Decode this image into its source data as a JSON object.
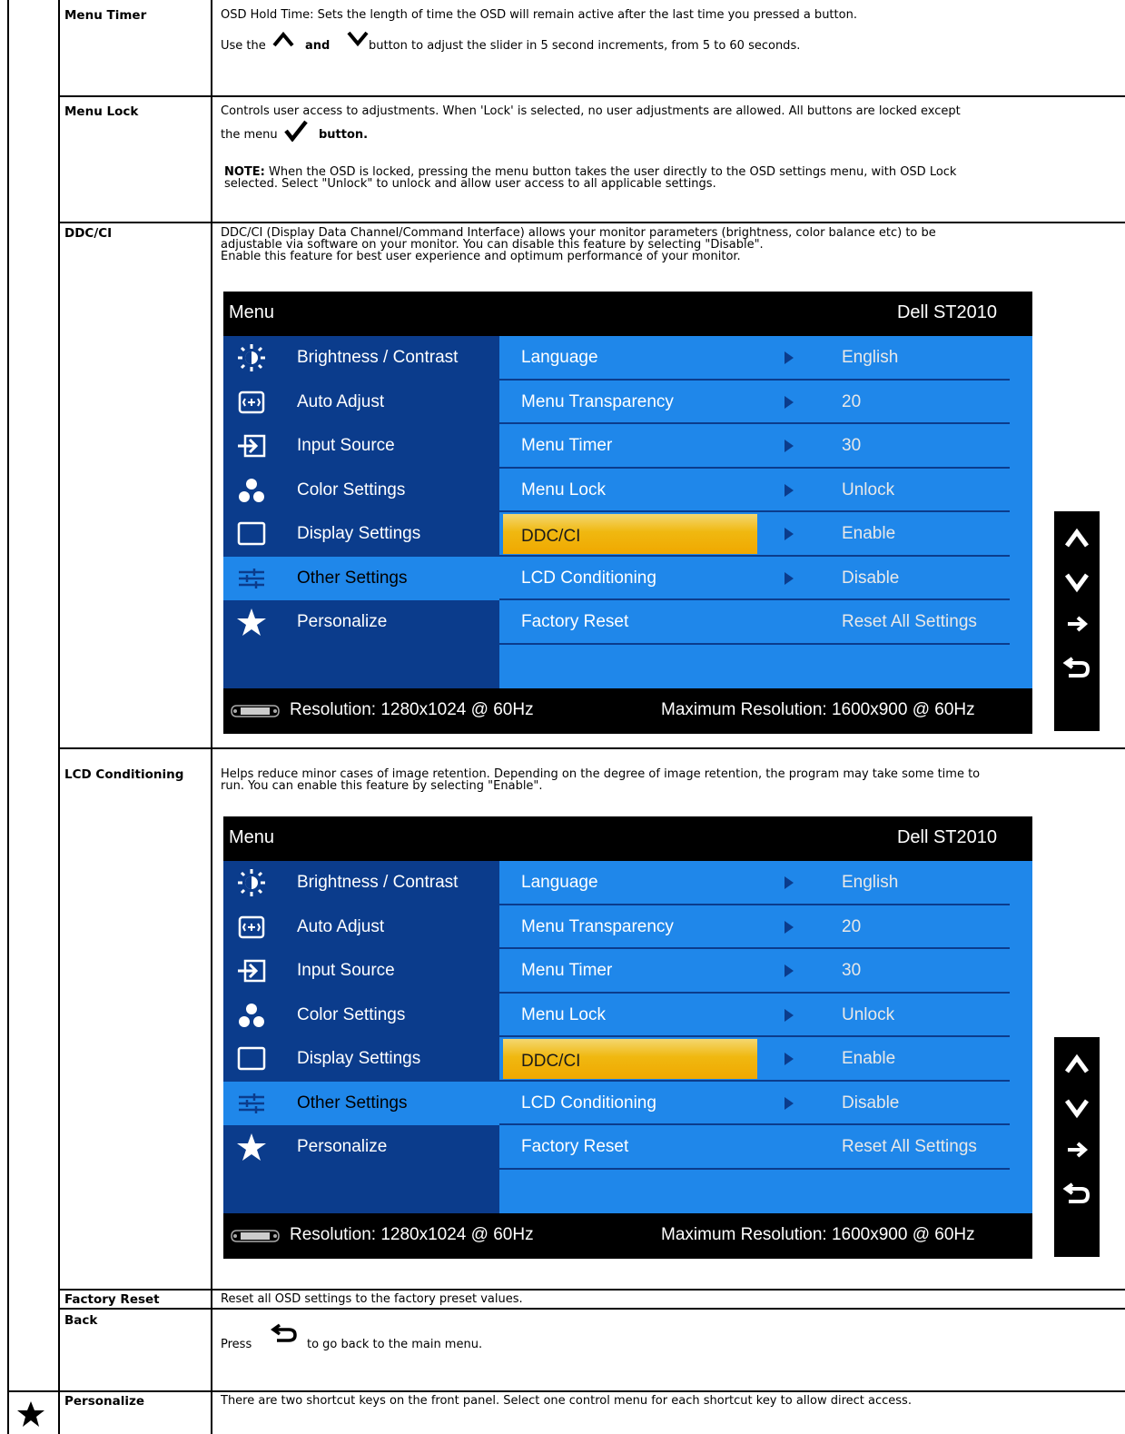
{
  "rows": {
    "menu_timer": {
      "label": "Menu Timer",
      "line1": "OSD Hold Time: Sets the length of time the OSD will remain active after the last time you pressed a button.",
      "line2_pre": "Use the",
      "line2_and": "and",
      "line2_post": "button to adjust the slider in 5 second increments, from 5 to 60 seconds."
    },
    "menu_lock": {
      "label": "Menu Lock",
      "line1": "Controls user access to adjustments. When 'Lock' is selected, no user adjustments are allowed. All buttons are locked except",
      "line2_pre": "the menu",
      "line2_post": "button.",
      "note_label": "NOTE:",
      "note_text": "When the OSD is locked, pressing the menu button takes the user directly to the OSD settings menu, with OSD Lock",
      "note_text2": "selected. Select \"Unlock\" to unlock and allow user access to all applicable settings."
    },
    "ddcci": {
      "label": "DDC/CI",
      "line1": "DDC/CI (Display Data Channel/Command Interface) allows your monitor parameters (brightness, color balance etc) to be",
      "line2": "adjustable via software on your monitor. You can disable this feature by selecting \"Disable\".",
      "line3": "Enable this feature for best user experience and optimum performance of your monitor."
    },
    "lcd_conditioning": {
      "label": "LCD Conditioning",
      "line1": "Helps reduce minor cases of image retention. Depending on the degree of image retention, the program may take some time to",
      "line2": "run. You can enable this feature by selecting \"Enable\"."
    },
    "factory_reset": {
      "label": "Factory Reset",
      "text": "Reset all OSD settings to the factory preset values."
    },
    "back": {
      "label": "Back",
      "pre": "Press",
      "post": "to go back to the main menu."
    },
    "personalize": {
      "label": "Personalize",
      "text": "There are two shortcut keys on the front panel. Select one control menu for each shortcut key to allow direct access."
    }
  },
  "osd": {
    "title": "Menu",
    "model": "Dell ST2010",
    "left_items": [
      {
        "label": "Brightness / Contrast",
        "icon": "brightness-icon"
      },
      {
        "label": "Auto Adjust",
        "icon": "auto-adjust-icon"
      },
      {
        "label": "Input Source",
        "icon": "input-source-icon"
      },
      {
        "label": "Color Settings",
        "icon": "color-settings-icon"
      },
      {
        "label": "Display Settings",
        "icon": "display-settings-icon"
      },
      {
        "label": "Other Settings",
        "icon": "other-settings-icon",
        "selected": true
      },
      {
        "label": "Personalize",
        "icon": "star-icon"
      }
    ],
    "right_items": [
      {
        "name": "Language",
        "value": "English"
      },
      {
        "name": "Menu Transparency",
        "value": "20"
      },
      {
        "name": "Menu Timer",
        "value": "30"
      },
      {
        "name": "Menu Lock",
        "value": "Unlock"
      },
      {
        "name": "DDC/CI",
        "value": "Enable",
        "highlighted": true
      },
      {
        "name": "LCD Conditioning",
        "value": "Disable"
      },
      {
        "name": "Factory Reset",
        "value": "Reset All Settings"
      }
    ],
    "resolution": "Resolution: 1280x1024 @ 60Hz",
    "max_resolution": "Maximum  Resolution: 1600x900 @ 60Hz"
  },
  "colors": {
    "osd_dark_blue": "#0b3c8c",
    "osd_light_blue": "#1f87ea",
    "highlight_gold": "#f0b810"
  }
}
